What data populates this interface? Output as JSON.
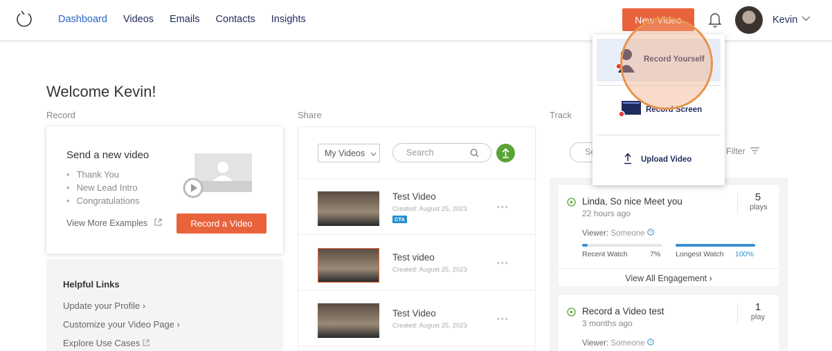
{
  "nav": {
    "items": [
      "Dashboard",
      "Videos",
      "Emails",
      "Contacts",
      "Insights"
    ],
    "active": "Dashboard",
    "new_video": "New Video",
    "user": "Kevin"
  },
  "welcome": "Welcome Kevin!",
  "sections": {
    "record": "Record",
    "share": "Share",
    "track": "Track"
  },
  "record_card": {
    "title": "Send a new video",
    "bullets": [
      "Thank You",
      "New Lead Intro",
      "Congratulations"
    ],
    "more": "View More Examples",
    "button": "Record a Video"
  },
  "helpful": {
    "title": "Helpful Links",
    "links": [
      "Update your Profile",
      "Customize your Video Page",
      "Explore Use Cases"
    ]
  },
  "share": {
    "filter": "My Videos",
    "search_placeholder": "Search",
    "videos": [
      {
        "title": "Test Video",
        "date": "Created: August 25, 2023",
        "badge": "CTA"
      },
      {
        "title": "Test video",
        "date": "Created: August 25, 2023",
        "badge": ""
      },
      {
        "title": "Test Video",
        "date": "Created: August 25, 2023",
        "badge": ""
      }
    ]
  },
  "track": {
    "search_placeholder": "Se",
    "filter": "Filter",
    "cards": [
      {
        "name": "Linda, So nice Meet you",
        "when": "22 hours ago",
        "plays": "5",
        "plays_label": "plays",
        "viewer_label": "Viewer:",
        "viewer": "Someone",
        "recent_label": "Recent Watch",
        "recent": "7%",
        "longest_label": "Longest Watch",
        "longest": "100%",
        "recent_frac": 0.07,
        "longest_frac": 1.0,
        "view_all": "View All Engagement"
      },
      {
        "name": "Record a Video test",
        "when": "3 months ago",
        "plays": "1",
        "plays_label": "play",
        "viewer_label": "Viewer:",
        "viewer": "Someone"
      }
    ]
  },
  "dropdown": {
    "items": [
      "Record Yourself",
      "Record Screen",
      "Upload Video"
    ]
  },
  "colors": {
    "accent": "#e8633c",
    "nav_active": "#2a64c5",
    "nav": "#1f2b5c",
    "green": "#5aa436",
    "link_blue": "#2a8fce"
  }
}
